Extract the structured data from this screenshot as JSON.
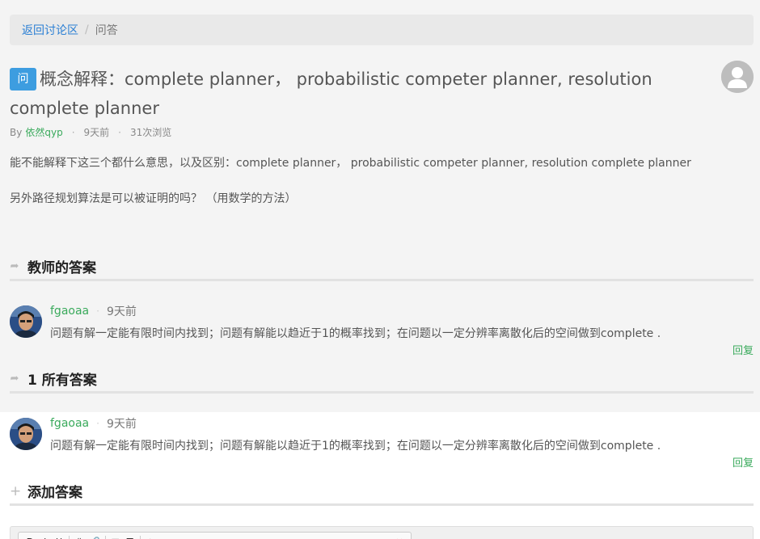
{
  "breadcrumb": {
    "back_label": "返回讨论区",
    "separator": "/",
    "current": "问答"
  },
  "question": {
    "badge": "问",
    "title": "概念解释：complete planner， probabilistic competer planner, resolution complete planner",
    "by_label": "By",
    "author": "依然qyp",
    "time": "9天前",
    "views": "31次浏览",
    "body": [
      "能不能解释下这三个都什么意思，以及区别：complete planner， probabilistic competer planner, resolution complete planner",
      "另外路径规划算法是可以被证明的吗？ （用数学的方法）"
    ]
  },
  "sections": {
    "teacher": "教师的答案",
    "all": "1 所有答案",
    "add": "添加答案"
  },
  "answers": [
    {
      "user": "fgaoaa",
      "time": "9天前",
      "text": "问题有解一定能有限时间内找到；问题有解能以趋近于1的概率找到；在问题以一定分辨率离散化后的空间做到complete .",
      "reply": "回复"
    },
    {
      "user": "fgaoaa",
      "time": "9天前",
      "text": "问题有解一定能有限时间内找到；问题有解能以趋近于1的概率找到；在问题以一定分辨率离散化后的空间做到complete .",
      "reply": "回复"
    }
  ],
  "colors": {
    "accent_blue": "#3d9de0",
    "link_green": "#3aaa5c",
    "breadcrumb_link": "#2a7fd4"
  },
  "icons": {
    "section_teacher": "share-arrow-icon",
    "section_all": "share-arrow-icon",
    "section_add": "plus-icon"
  }
}
